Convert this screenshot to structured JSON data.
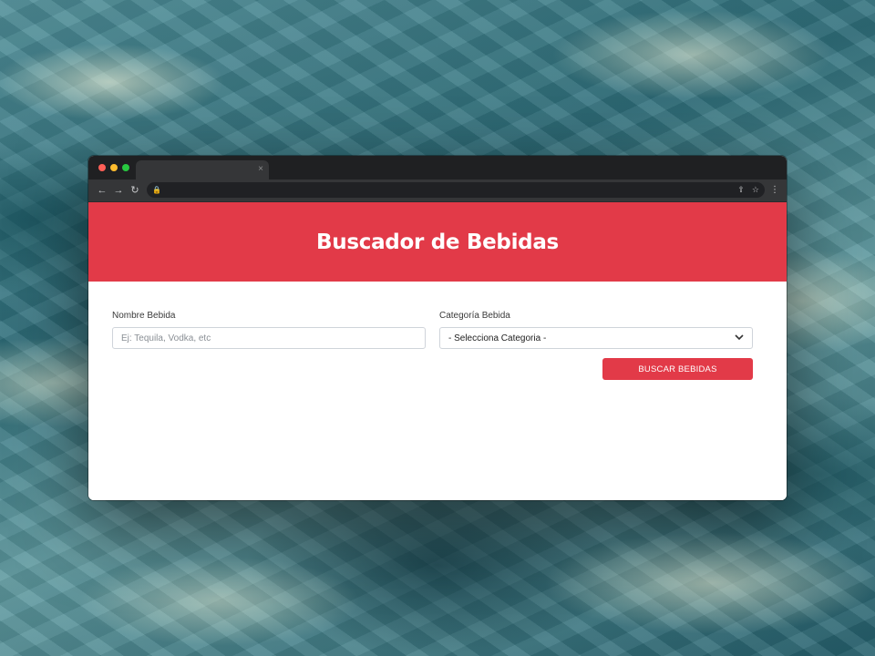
{
  "browser": {
    "tab_close": "×",
    "nav_back": "←",
    "nav_forward": "→",
    "nav_reload": "↻",
    "lock": "🔒",
    "share_icon": "⇪",
    "star_icon": "☆",
    "menu": "⋮"
  },
  "header": {
    "title": "Buscador de Bebidas",
    "bg_color": "#e23a48"
  },
  "form": {
    "name_label": "Nombre Bebida",
    "name_placeholder": "Ej: Tequila, Vodka, etc",
    "name_value": "",
    "category_label": "Categoría Bebida",
    "category_selected": "- Selecciona Categoria -",
    "search_button": "BUSCAR BEBIDAS"
  }
}
